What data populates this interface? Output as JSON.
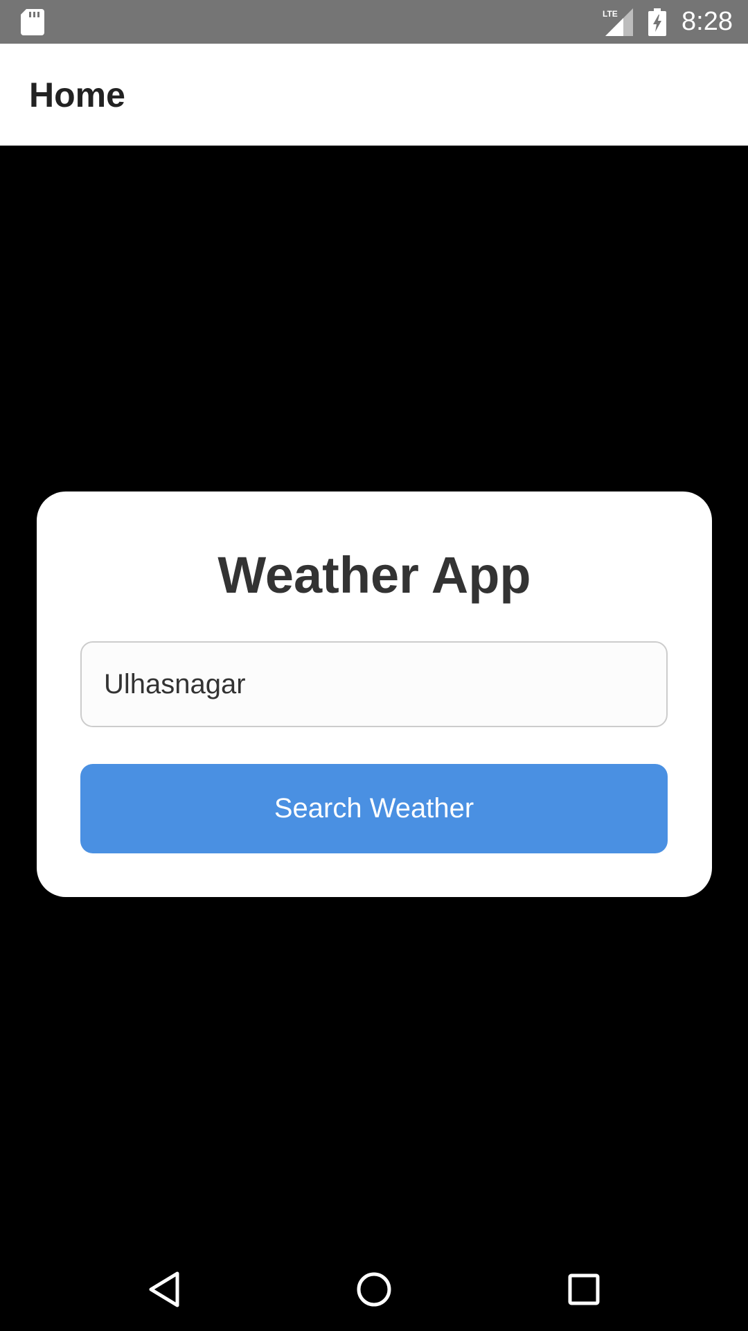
{
  "status_bar": {
    "network": "LTE",
    "time": "8:28",
    "icons": [
      "sd-card-icon",
      "lte-signal-icon",
      "battery-charging-icon"
    ]
  },
  "app_bar": {
    "title": "Home"
  },
  "card": {
    "heading": "Weather App",
    "city_input": {
      "value": "Ulhasnagar",
      "placeholder": ""
    },
    "search_button": {
      "label": "Search Weather"
    }
  },
  "nav_bar": {
    "icons": [
      "back-icon",
      "home-icon",
      "recents-icon"
    ]
  },
  "colors": {
    "status_bar": "#757575",
    "app_bar": "#ffffff",
    "background": "#000000",
    "card": "#ffffff",
    "button": "#4a90e2",
    "heading_text": "#333333"
  }
}
